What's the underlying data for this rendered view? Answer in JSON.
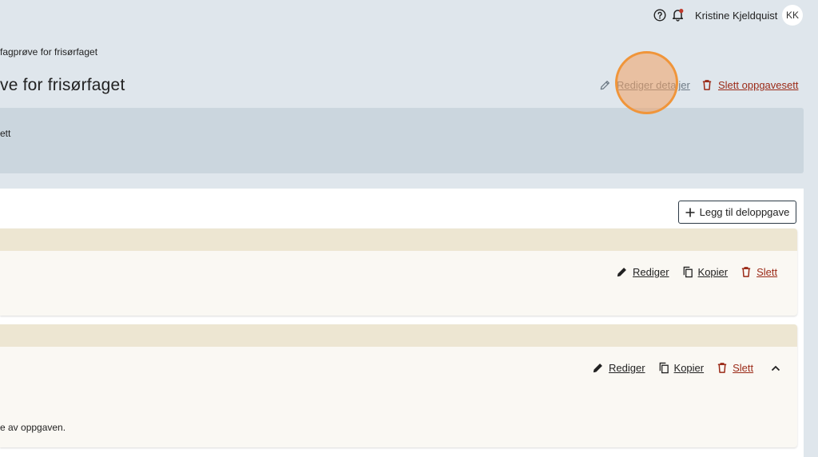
{
  "header": {
    "help_icon": "help-circle-icon",
    "bell_icon": "bell-notification-icon",
    "user_name": "Kristine Kjeldquist",
    "avatar_initials": "KK"
  },
  "breadcrumb": "fagprøve for frisørfaget",
  "page": {
    "title": "ve for frisørfaget",
    "edit_label": "Rediger detaljer",
    "delete_label": "Slett oppgavesett"
  },
  "infobox": {
    "text": "ett"
  },
  "panel": {
    "add_label": "Legg til deloppgave",
    "tasks": [
      {
        "edit": "Rediger",
        "copy": "Kopier",
        "delete": "Slett",
        "description": ""
      },
      {
        "edit": "Rediger",
        "copy": "Kopier",
        "delete": "Slett",
        "description": "e av oppgaven."
      }
    ]
  },
  "colors": {
    "page_bg": "#dfe6ec",
    "infobox_bg": "#cbd6de",
    "card_band": "#ede6d2",
    "card_bg": "#faf8f3",
    "danger": "#9b2a17",
    "cursor_highlight": "#f0953a"
  }
}
